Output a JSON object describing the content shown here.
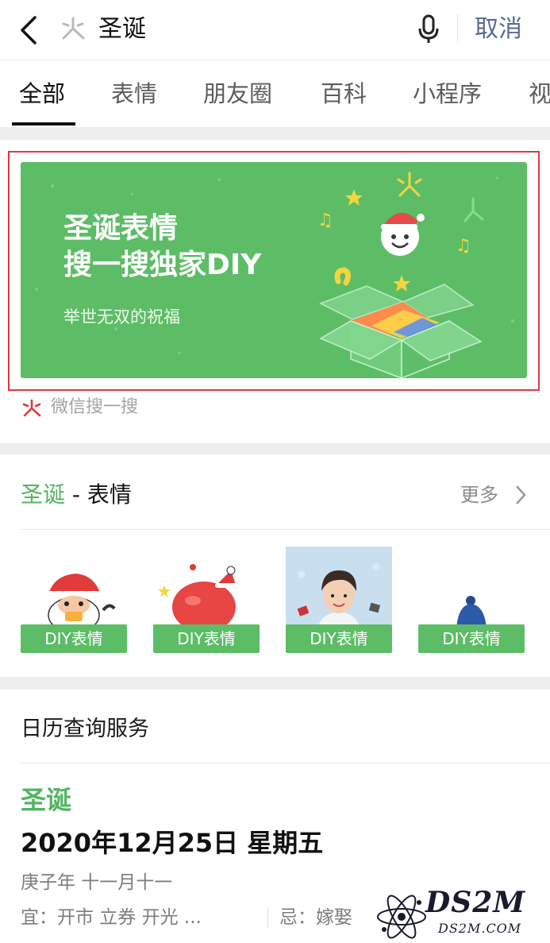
{
  "search_bar": {
    "query": "圣诞",
    "cancel_label": "取消"
  },
  "tabs": [
    {
      "label": "全部",
      "active": true
    },
    {
      "label": "表情",
      "active": false
    },
    {
      "label": "朋友圈",
      "active": false
    },
    {
      "label": "百科",
      "active": false
    },
    {
      "label": "小程序",
      "active": false
    },
    {
      "label": "视",
      "active": false
    }
  ],
  "banner": {
    "title_line1": "圣诞表情",
    "title_line2": "搜一搜独家DIY",
    "subtitle": "举世无双的祝福",
    "source": "微信搜一搜",
    "highlight_color": "#e0393e"
  },
  "stickers": {
    "title_highlight": "圣诞",
    "title_rest": " - 表情",
    "more_label": "更多",
    "items": [
      {
        "label": "DIY表情",
        "icon": "santa-sticker"
      },
      {
        "label": "DIY表情",
        "icon": "apple-sticker"
      },
      {
        "label": "DIY表情",
        "icon": "person-photo-sticker"
      },
      {
        "label": "DIY表情",
        "icon": "blue-hat-sticker"
      }
    ]
  },
  "calendar": {
    "header": "日历查询服务",
    "holiday": "圣诞",
    "date": "2020年12月25日 星期五",
    "lunar": "庚子年 十一月十一",
    "yi": "宜：开市 立券 开光 ...",
    "ji": "忌：嫁娶"
  },
  "watermark": {
    "big": "DS2M",
    "small": "DS2M.COM"
  },
  "colors": {
    "accent_green": "#5cbd66",
    "text_green": "#53b464",
    "link_blue": "#576b95"
  }
}
